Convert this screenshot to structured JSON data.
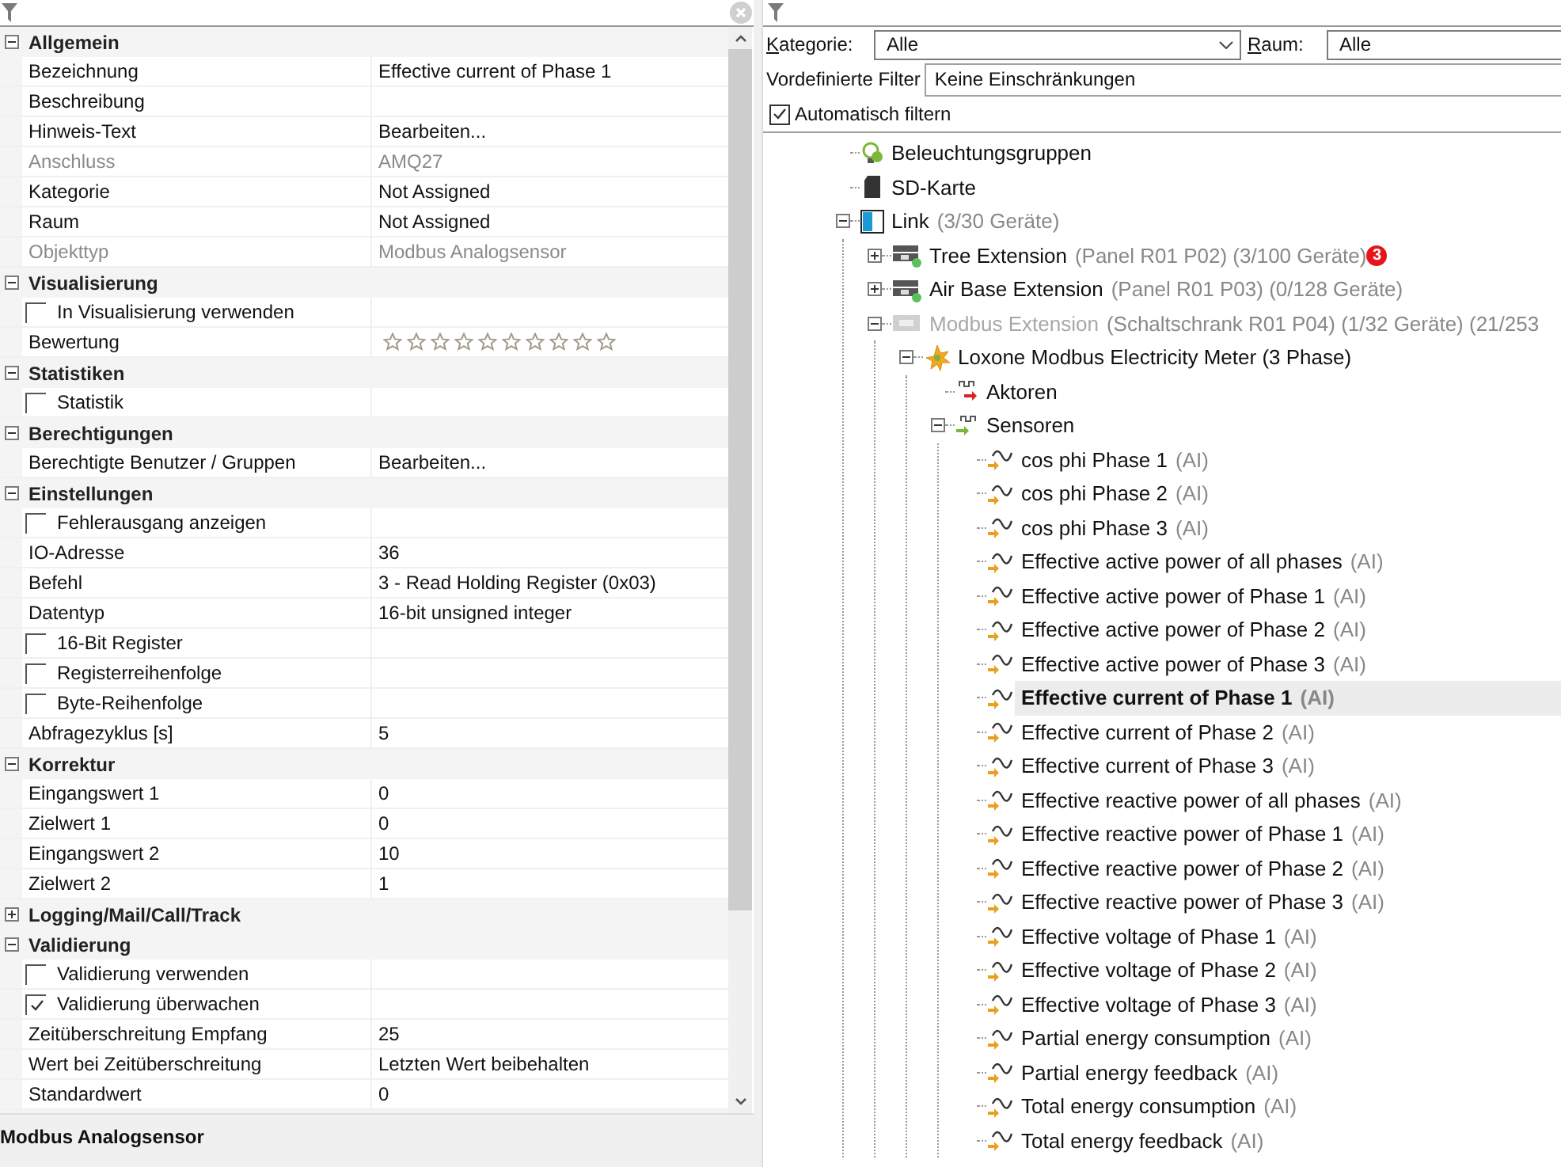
{
  "property_grid": {
    "sections": [
      {
        "title": "Allgemein",
        "expanded": true,
        "rows": [
          {
            "kind": "text",
            "label": "Bezeichnung",
            "value": "Effective current of Phase 1",
            "disabled": false
          },
          {
            "kind": "text",
            "label": "Beschreibung",
            "disabled": false
          },
          {
            "kind": "text",
            "label": "Hinweis-Text",
            "value": "Bearbeiten...",
            "disabled": false
          },
          {
            "kind": "text",
            "label": "Anschluss",
            "value": "AMQ27",
            "disabled": true
          },
          {
            "kind": "text",
            "label": "Kategorie",
            "value": "Not Assigned",
            "disabled": false
          },
          {
            "kind": "text",
            "label": "Raum",
            "value": "Not Assigned",
            "disabled": false
          },
          {
            "kind": "text",
            "label": "Objekttyp",
            "value": "Modbus Analogsensor",
            "disabled": true
          }
        ]
      },
      {
        "title": "Visualisierung",
        "expanded": true,
        "rows": [
          {
            "kind": "checkbox",
            "label": "In Visualisierung verwenden",
            "checked": false
          },
          {
            "kind": "rating",
            "label": "Bewertung",
            "stars": 0
          }
        ]
      },
      {
        "title": "Statistiken",
        "expanded": true,
        "rows": [
          {
            "kind": "checkbox",
            "label": "Statistik",
            "checked": false
          }
        ]
      },
      {
        "title": "Berechtigungen",
        "expanded": true,
        "rows": [
          {
            "kind": "text",
            "label": "Berechtigte Benutzer / Gruppen",
            "value": "Bearbeiten...",
            "disabled": false
          }
        ]
      },
      {
        "title": "Einstellungen",
        "expanded": true,
        "rows": [
          {
            "kind": "checkbox",
            "label": "Fehlerausgang anzeigen",
            "checked": false
          },
          {
            "kind": "text",
            "label": "IO-Adresse",
            "value": "36",
            "disabled": false
          },
          {
            "kind": "text",
            "label": "Befehl",
            "value": "3 - Read Holding Register (0x03)",
            "disabled": false
          },
          {
            "kind": "text",
            "label": "Datentyp",
            "value": "16-bit unsigned integer",
            "disabled": false
          },
          {
            "kind": "checkbox",
            "label": "16-Bit Register",
            "checked": false
          },
          {
            "kind": "checkbox",
            "label": "Registerreihenfolge",
            "checked": false
          },
          {
            "kind": "checkbox",
            "label": "Byte-Reihenfolge",
            "checked": false
          },
          {
            "kind": "text",
            "label": "Abfragezyklus [s]",
            "value": "5",
            "disabled": false
          }
        ]
      },
      {
        "title": "Korrektur",
        "expanded": true,
        "rows": [
          {
            "kind": "text",
            "label": "Eingangswert 1",
            "value": "0",
            "disabled": false
          },
          {
            "kind": "text",
            "label": "Zielwert 1",
            "value": "0",
            "disabled": false
          },
          {
            "kind": "text",
            "label": "Eingangswert 2",
            "value": "10",
            "disabled": false
          },
          {
            "kind": "text",
            "label": "Zielwert 2",
            "value": "1",
            "disabled": false
          }
        ]
      },
      {
        "title": "Logging/Mail/Call/Track",
        "expanded": false
      },
      {
        "title": "Validierung",
        "expanded": true,
        "rows": [
          {
            "kind": "checkbox",
            "label": "Validierung verwenden",
            "checked": false
          },
          {
            "kind": "checkbox",
            "label": "Validierung überwachen",
            "checked": true
          },
          {
            "kind": "text",
            "label": "Zeitüberschreitung Empfang",
            "value": "25",
            "disabled": false
          },
          {
            "kind": "text",
            "label": "Wert bei Zeitüberschreitung",
            "value": "Letzten Wert beibehalten",
            "disabled": false
          },
          {
            "kind": "text",
            "label": "Standardwert",
            "value": "0",
            "disabled": false
          }
        ]
      }
    ]
  },
  "description_panel": {
    "title": "Modbus Analogsensor"
  },
  "filters": {
    "category": {
      "label": "Kategorie:",
      "value": "Alle"
    },
    "room": {
      "label": "Raum:",
      "value": "Alle"
    },
    "predefined": {
      "label": "Vordefinierte Filter",
      "value": "Keine Einschränkungen"
    },
    "auto_filter": {
      "label": "Automatisch filtern",
      "checked": true
    }
  },
  "tree": [
    {
      "kind": "lighting",
      "label": "Beleuchtungsgruppen",
      "selected": false,
      "disabled": false
    },
    {
      "kind": "sd-card",
      "label": "SD-Karte",
      "selected": false,
      "disabled": false
    },
    {
      "kind": "link",
      "label": "Link",
      "detail": "(3/30 Geräte)",
      "expanded": true,
      "selected": false,
      "disabled": false,
      "children": [
        {
          "kind": "tree-extension",
          "label": "Tree Extension",
          "detail": "(Panel R01 P02) (3/100 Geräte)",
          "badge": "3",
          "expanded": false,
          "selected": false,
          "disabled": false
        },
        {
          "kind": "air-extension",
          "label": "Air Base Extension",
          "detail": "(Panel R01 P03) (0/128 Geräte)",
          "expanded": false,
          "selected": false,
          "disabled": false
        },
        {
          "kind": "modbus-extension",
          "label": "Modbus Extension",
          "detail": "(Schaltschrank R01 P04) (1/32 Geräte) (21/253",
          "expanded": true,
          "selected": false,
          "disabled": true,
          "children": [
            {
              "kind": "meter",
              "label": "Loxone Modbus Electricity Meter (3 Phase)",
              "expanded": true,
              "selected": false,
              "disabled": false,
              "children": [
                {
                  "kind": "actors",
                  "label": "Aktoren",
                  "selected": false,
                  "disabled": false
                },
                {
                  "kind": "sensors",
                  "label": "Sensoren",
                  "expanded": true,
                  "selected": false,
                  "disabled": false,
                  "children": [
                    {
                      "kind": "analog",
                      "label": "cos phi Phase 1",
                      "detail": "(AI)",
                      "selected": false,
                      "disabled": false
                    },
                    {
                      "kind": "analog",
                      "label": "cos phi Phase 2",
                      "detail": "(AI)",
                      "selected": false,
                      "disabled": false
                    },
                    {
                      "kind": "analog",
                      "label": "cos phi Phase 3",
                      "detail": "(AI)",
                      "selected": false,
                      "disabled": false
                    },
                    {
                      "kind": "analog",
                      "label": "Effective active power of all phases",
                      "detail": "(AI)",
                      "selected": false,
                      "disabled": false
                    },
                    {
                      "kind": "analog",
                      "label": "Effective active power of Phase 1",
                      "detail": "(AI)",
                      "selected": false,
                      "disabled": false
                    },
                    {
                      "kind": "analog",
                      "label": "Effective active power of Phase 2",
                      "detail": "(AI)",
                      "selected": false,
                      "disabled": false
                    },
                    {
                      "kind": "analog",
                      "label": "Effective active power of Phase 3",
                      "detail": "(AI)",
                      "selected": false,
                      "disabled": false
                    },
                    {
                      "kind": "analog",
                      "label": "Effective current of Phase 1",
                      "detail": "(AI)",
                      "selected": true,
                      "disabled": false
                    },
                    {
                      "kind": "analog",
                      "label": "Effective current of Phase 2",
                      "detail": "(AI)",
                      "selected": false,
                      "disabled": false
                    },
                    {
                      "kind": "analog",
                      "label": "Effective current of Phase 3",
                      "detail": "(AI)",
                      "selected": false,
                      "disabled": false
                    },
                    {
                      "kind": "analog",
                      "label": "Effective reactive power of all phases",
                      "detail": "(AI)",
                      "selected": false,
                      "disabled": false
                    },
                    {
                      "kind": "analog",
                      "label": "Effective reactive power of Phase 1",
                      "detail": "(AI)",
                      "selected": false,
                      "disabled": false
                    },
                    {
                      "kind": "analog",
                      "label": "Effective reactive power of Phase 2",
                      "detail": "(AI)",
                      "selected": false,
                      "disabled": false
                    },
                    {
                      "kind": "analog",
                      "label": "Effective reactive power of Phase 3",
                      "detail": "(AI)",
                      "selected": false,
                      "disabled": false
                    },
                    {
                      "kind": "analog",
                      "label": "Effective voltage of Phase 1",
                      "detail": "(AI)",
                      "selected": false,
                      "disabled": false
                    },
                    {
                      "kind": "analog",
                      "label": "Effective voltage of Phase 2",
                      "detail": "(AI)",
                      "selected": false,
                      "disabled": false
                    },
                    {
                      "kind": "analog",
                      "label": "Effective voltage of Phase 3",
                      "detail": "(AI)",
                      "selected": false,
                      "disabled": false
                    },
                    {
                      "kind": "analog",
                      "label": "Partial energy consumption",
                      "detail": "(AI)",
                      "selected": false,
                      "disabled": false
                    },
                    {
                      "kind": "analog",
                      "label": "Partial energy feedback",
                      "detail": "(AI)",
                      "selected": false,
                      "disabled": false
                    },
                    {
                      "kind": "analog",
                      "label": "Total energy consumption",
                      "detail": "(AI)",
                      "selected": false,
                      "disabled": false
                    },
                    {
                      "kind": "analog",
                      "label": "Total energy feedback",
                      "detail": "(AI)",
                      "selected": false,
                      "disabled": false
                    }
                  ]
                }
              ]
            }
          ]
        }
      ]
    }
  ]
}
